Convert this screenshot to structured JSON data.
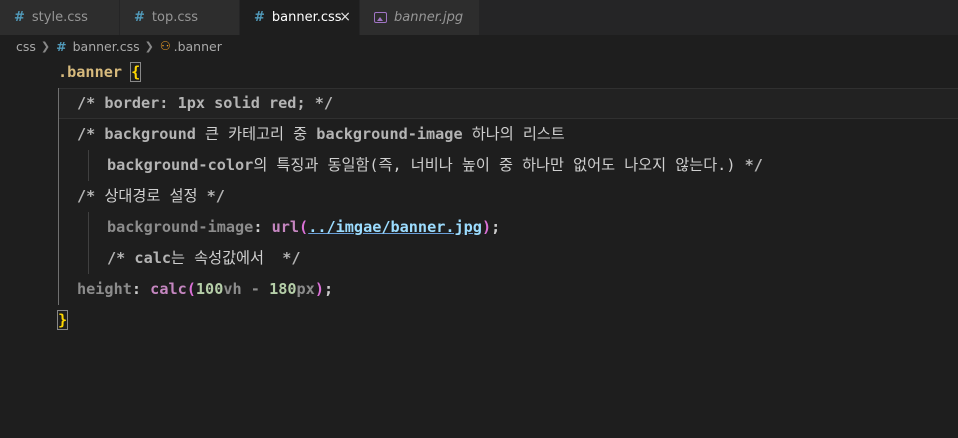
{
  "tabs": [
    {
      "label": "style.css",
      "icon": "css-hash-icon"
    },
    {
      "label": "top.css",
      "icon": "css-hash-icon"
    },
    {
      "label": "banner.css",
      "icon": "css-hash-icon",
      "active": true,
      "close": "×"
    },
    {
      "label": "banner.jpg",
      "icon": "image-file-icon"
    }
  ],
  "breadcrumb": {
    "folder": "css",
    "file": "banner.css",
    "symbol": ".banner"
  },
  "code": {
    "l1_selector": ".banner",
    "l1_brace": "{",
    "l2": "/* border: 1px solid red; */",
    "l3_a": "/* background",
    "l3_b": " 큰 카테고리 중 ",
    "l3_c": "background-image",
    "l3_d": " 하나의 리스트",
    "l4_a": "background-color",
    "l4_b": "의 특징과 동일함(즉, 너비나 높이 중 하나만 없어도 나오지 않는다.)",
    "l4_c": " */",
    "l5_a": "/* ",
    "l5_b": "상대경로 설정",
    "l5_c": " */",
    "l6_prop": "background-image",
    "l6_colon": ": ",
    "l6_fn": "url",
    "l6_open": "(",
    "l6_url": "../imgae/banner.jpg",
    "l6_close": ")",
    "l6_semi": ";",
    "l7_a": "/* calc",
    "l7_b": "는 속성값에서",
    "l7_c": "  */",
    "l8_prop": "height",
    "l8_colon": ": ",
    "l8_fn": "calc",
    "l8_open": "(",
    "l8_num1": "100",
    "l8_unit1": "vh",
    "l8_op": " - ",
    "l8_num2": "180",
    "l8_unit2": "px",
    "l8_close": ")",
    "l8_semi": ";",
    "l9_brace": "}"
  },
  "colors": {
    "background": "#1e1e1e",
    "tabbar": "#252526",
    "css_icon": "#519aba",
    "image_icon": "#a074c4",
    "brace": "#ffd700"
  }
}
